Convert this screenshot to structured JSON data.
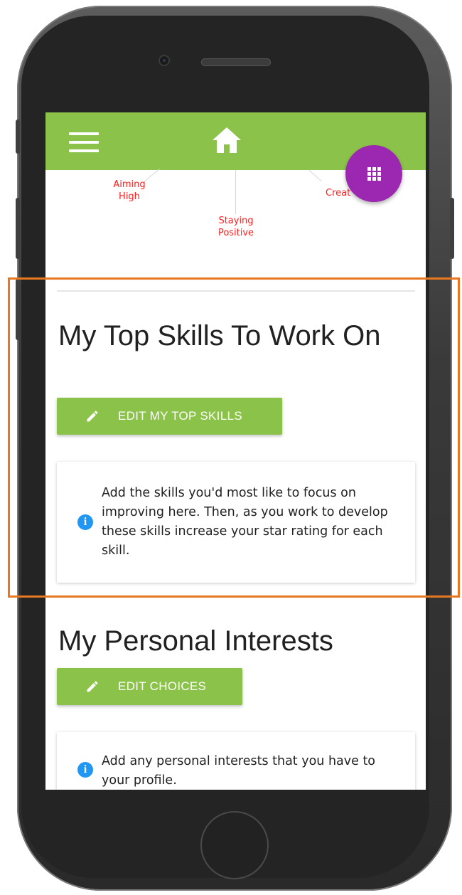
{
  "radar": {
    "labels": [
      "Aiming\nHigh",
      "Staying\nPositive",
      "Creat"
    ]
  },
  "skills": {
    "title": "My Top Skills To Work On",
    "edit_button_label": "EDIT MY TOP SKILLS",
    "info_text": "Add the skills you'd most like to focus on improving here. Then, as you work to develop these skills increase your star rating for each skill.",
    "info_icon_glyph": "i"
  },
  "interests": {
    "title": "My Personal Interests",
    "edit_button_label": "EDIT CHOICES",
    "info_text": "Add any personal interests that you have to your profile.",
    "info_icon_glyph": "i"
  },
  "icons": {
    "menu": "hamburger-menu-icon",
    "home": "home-icon",
    "apps": "grid-apps-icon",
    "edit": "pencil-icon",
    "info": "info-icon"
  },
  "colors": {
    "app_bar": "#8bc34a",
    "fab": "#9c27b0",
    "button": "#8bc34a",
    "info_icon": "#2196f3",
    "radar_label": "#ff1f1f",
    "highlight": "#e8781f"
  }
}
